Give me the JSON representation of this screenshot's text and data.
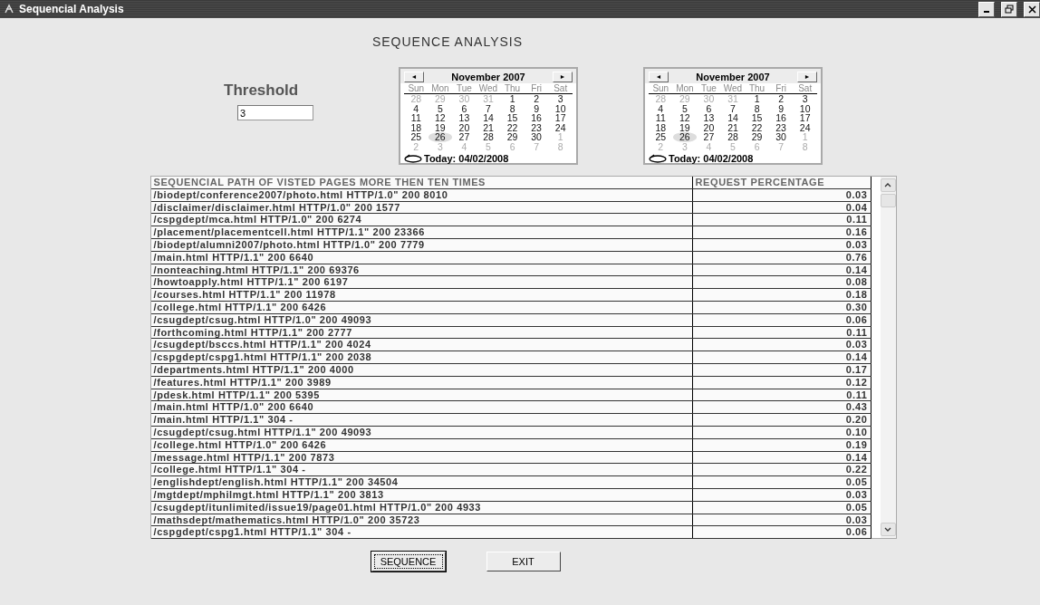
{
  "window": {
    "title": "Sequencial Analysis"
  },
  "heading": "SEQUENCE ANALYSIS",
  "threshold": {
    "label": "Threshold",
    "value": "3"
  },
  "calendars": [
    {
      "month": "November 2007",
      "prev": "◄",
      "next": "►",
      "weekdays": [
        "Sun",
        "Mon",
        "Tue",
        "Wed",
        "Thu",
        "Fri",
        "Sat"
      ],
      "today": "Today: 04/02/2008",
      "days": [
        {
          "text": "28",
          "muted": true,
          "selected": false
        },
        {
          "text": "29",
          "muted": true,
          "selected": false
        },
        {
          "text": "30",
          "muted": true,
          "selected": false
        },
        {
          "text": "31",
          "muted": true,
          "selected": false
        },
        {
          "text": "1",
          "muted": false,
          "selected": false
        },
        {
          "text": "2",
          "muted": false,
          "selected": false
        },
        {
          "text": "3",
          "muted": false,
          "selected": false
        },
        {
          "text": "4",
          "muted": false,
          "selected": false
        },
        {
          "text": "5",
          "muted": false,
          "selected": false
        },
        {
          "text": "6",
          "muted": false,
          "selected": false
        },
        {
          "text": "7",
          "muted": false,
          "selected": false
        },
        {
          "text": "8",
          "muted": false,
          "selected": false
        },
        {
          "text": "9",
          "muted": false,
          "selected": false
        },
        {
          "text": "10",
          "muted": false,
          "selected": false
        },
        {
          "text": "11",
          "muted": false,
          "selected": false
        },
        {
          "text": "12",
          "muted": false,
          "selected": false
        },
        {
          "text": "13",
          "muted": false,
          "selected": false
        },
        {
          "text": "14",
          "muted": false,
          "selected": false
        },
        {
          "text": "15",
          "muted": false,
          "selected": false
        },
        {
          "text": "16",
          "muted": false,
          "selected": false
        },
        {
          "text": "17",
          "muted": false,
          "selected": false
        },
        {
          "text": "18",
          "muted": false,
          "selected": false
        },
        {
          "text": "19",
          "muted": false,
          "selected": false
        },
        {
          "text": "20",
          "muted": false,
          "selected": false
        },
        {
          "text": "21",
          "muted": false,
          "selected": false
        },
        {
          "text": "22",
          "muted": false,
          "selected": false
        },
        {
          "text": "23",
          "muted": false,
          "selected": false
        },
        {
          "text": "24",
          "muted": false,
          "selected": false
        },
        {
          "text": "25",
          "muted": false,
          "selected": false
        },
        {
          "text": "26",
          "muted": false,
          "selected": true
        },
        {
          "text": "27",
          "muted": false,
          "selected": false
        },
        {
          "text": "28",
          "muted": false,
          "selected": false
        },
        {
          "text": "29",
          "muted": false,
          "selected": false
        },
        {
          "text": "30",
          "muted": false,
          "selected": false
        },
        {
          "text": "1",
          "muted": true,
          "selected": false
        },
        {
          "text": "2",
          "muted": true,
          "selected": false
        },
        {
          "text": "3",
          "muted": true,
          "selected": false
        },
        {
          "text": "4",
          "muted": true,
          "selected": false
        },
        {
          "text": "5",
          "muted": true,
          "selected": false
        },
        {
          "text": "6",
          "muted": true,
          "selected": false
        },
        {
          "text": "7",
          "muted": true,
          "selected": false
        },
        {
          "text": "8",
          "muted": true,
          "selected": false
        }
      ]
    },
    {
      "month": "November 2007",
      "prev": "◄",
      "next": "►",
      "weekdays": [
        "Sun",
        "Mon",
        "Tue",
        "Wed",
        "Thu",
        "Fri",
        "Sat"
      ],
      "today": "Today: 04/02/2008",
      "days": [
        {
          "text": "28",
          "muted": true,
          "selected": false
        },
        {
          "text": "29",
          "muted": true,
          "selected": false
        },
        {
          "text": "30",
          "muted": true,
          "selected": false
        },
        {
          "text": "31",
          "muted": true,
          "selected": false
        },
        {
          "text": "1",
          "muted": false,
          "selected": false
        },
        {
          "text": "2",
          "muted": false,
          "selected": false
        },
        {
          "text": "3",
          "muted": false,
          "selected": false
        },
        {
          "text": "4",
          "muted": false,
          "selected": false
        },
        {
          "text": "5",
          "muted": false,
          "selected": false
        },
        {
          "text": "6",
          "muted": false,
          "selected": false
        },
        {
          "text": "7",
          "muted": false,
          "selected": false
        },
        {
          "text": "8",
          "muted": false,
          "selected": false
        },
        {
          "text": "9",
          "muted": false,
          "selected": false
        },
        {
          "text": "10",
          "muted": false,
          "selected": false
        },
        {
          "text": "11",
          "muted": false,
          "selected": false
        },
        {
          "text": "12",
          "muted": false,
          "selected": false
        },
        {
          "text": "13",
          "muted": false,
          "selected": false
        },
        {
          "text": "14",
          "muted": false,
          "selected": false
        },
        {
          "text": "15",
          "muted": false,
          "selected": false
        },
        {
          "text": "16",
          "muted": false,
          "selected": false
        },
        {
          "text": "17",
          "muted": false,
          "selected": false
        },
        {
          "text": "18",
          "muted": false,
          "selected": false
        },
        {
          "text": "19",
          "muted": false,
          "selected": false
        },
        {
          "text": "20",
          "muted": false,
          "selected": false
        },
        {
          "text": "21",
          "muted": false,
          "selected": false
        },
        {
          "text": "22",
          "muted": false,
          "selected": false
        },
        {
          "text": "23",
          "muted": false,
          "selected": false
        },
        {
          "text": "24",
          "muted": false,
          "selected": false
        },
        {
          "text": "25",
          "muted": false,
          "selected": false
        },
        {
          "text": "26",
          "muted": false,
          "selected": true
        },
        {
          "text": "27",
          "muted": false,
          "selected": false
        },
        {
          "text": "28",
          "muted": false,
          "selected": false
        },
        {
          "text": "29",
          "muted": false,
          "selected": false
        },
        {
          "text": "30",
          "muted": false,
          "selected": false
        },
        {
          "text": "1",
          "muted": true,
          "selected": false
        },
        {
          "text": "2",
          "muted": true,
          "selected": false
        },
        {
          "text": "3",
          "muted": true,
          "selected": false
        },
        {
          "text": "4",
          "muted": true,
          "selected": false
        },
        {
          "text": "5",
          "muted": true,
          "selected": false
        },
        {
          "text": "6",
          "muted": true,
          "selected": false
        },
        {
          "text": "7",
          "muted": true,
          "selected": false
        },
        {
          "text": "8",
          "muted": true,
          "selected": false
        }
      ]
    }
  ],
  "table": {
    "columns": [
      "SEQUENCIAL PATH OF VISTED PAGES MORE THEN TEN TIMES",
      "REQUEST PERCENTAGE"
    ],
    "rows": [
      [
        "/biodept/conference2007/photo.html HTTP/1.0\" 200 8010",
        "0.03"
      ],
      [
        "/disclaimer/disclaimer.html HTTP/1.0\" 200 1577",
        "0.04"
      ],
      [
        "/cspgdept/mca.html HTTP/1.0\" 200 6274",
        "0.11"
      ],
      [
        "/placement/placementcell.html HTTP/1.1\" 200 23366",
        "0.16"
      ],
      [
        "/biodept/alumni2007/photo.html HTTP/1.0\" 200 7779",
        "0.03"
      ],
      [
        "/main.html HTTP/1.1\" 200 6640",
        "0.76"
      ],
      [
        "/nonteaching.html HTTP/1.1\" 200 69376",
        "0.14"
      ],
      [
        "/howtoapply.html HTTP/1.1\" 200 6197",
        "0.08"
      ],
      [
        "/courses.html HTTP/1.1\" 200 11978",
        "0.18"
      ],
      [
        "/college.html HTTP/1.1\" 200 6426",
        "0.30"
      ],
      [
        "/csugdept/csug.html HTTP/1.0\" 200 49093",
        "0.06"
      ],
      [
        "/forthcoming.html HTTP/1.1\" 200 2777",
        "0.11"
      ],
      [
        "/csugdept/bsccs.html HTTP/1.1\" 200 4024",
        "0.03"
      ],
      [
        "/cspgdept/cspg1.html HTTP/1.1\" 200 2038",
        "0.14"
      ],
      [
        "/departments.html HTTP/1.1\" 200 4000",
        "0.17"
      ],
      [
        "/features.html HTTP/1.1\" 200 3989",
        "0.12"
      ],
      [
        "/pdesk.html HTTP/1.1\" 200 5395",
        "0.11"
      ],
      [
        "/main.html HTTP/1.0\" 200 6640",
        "0.43"
      ],
      [
        "/main.html HTTP/1.1\" 304 -",
        "0.20"
      ],
      [
        "/csugdept/csug.html HTTP/1.1\" 200 49093",
        "0.10"
      ],
      [
        "/college.html HTTP/1.0\" 200 6426",
        "0.19"
      ],
      [
        "/message.html HTTP/1.1\" 200 7873",
        "0.14"
      ],
      [
        "/college.html HTTP/1.1\" 304 -",
        "0.22"
      ],
      [
        "/englishdept/english.html HTTP/1.1\" 200 34504",
        "0.05"
      ],
      [
        "/mgtdept/mphilmgt.html HTTP/1.1\" 200 3813",
        "0.03"
      ],
      [
        "/csugdept/itunlimited/issue19/page01.html HTTP/1.0\" 200 4933",
        "0.05"
      ],
      [
        "/mathsdept/mathematics.html HTTP/1.0\" 200 35723",
        "0.03"
      ],
      [
        "/cspgdept/cspg1.html HTTP/1.1\" 304 -",
        "0.06"
      ]
    ]
  },
  "buttons": [
    {
      "label": "SEQUENCE",
      "focused": true
    },
    {
      "label": "EXIT",
      "focused": false
    }
  ]
}
